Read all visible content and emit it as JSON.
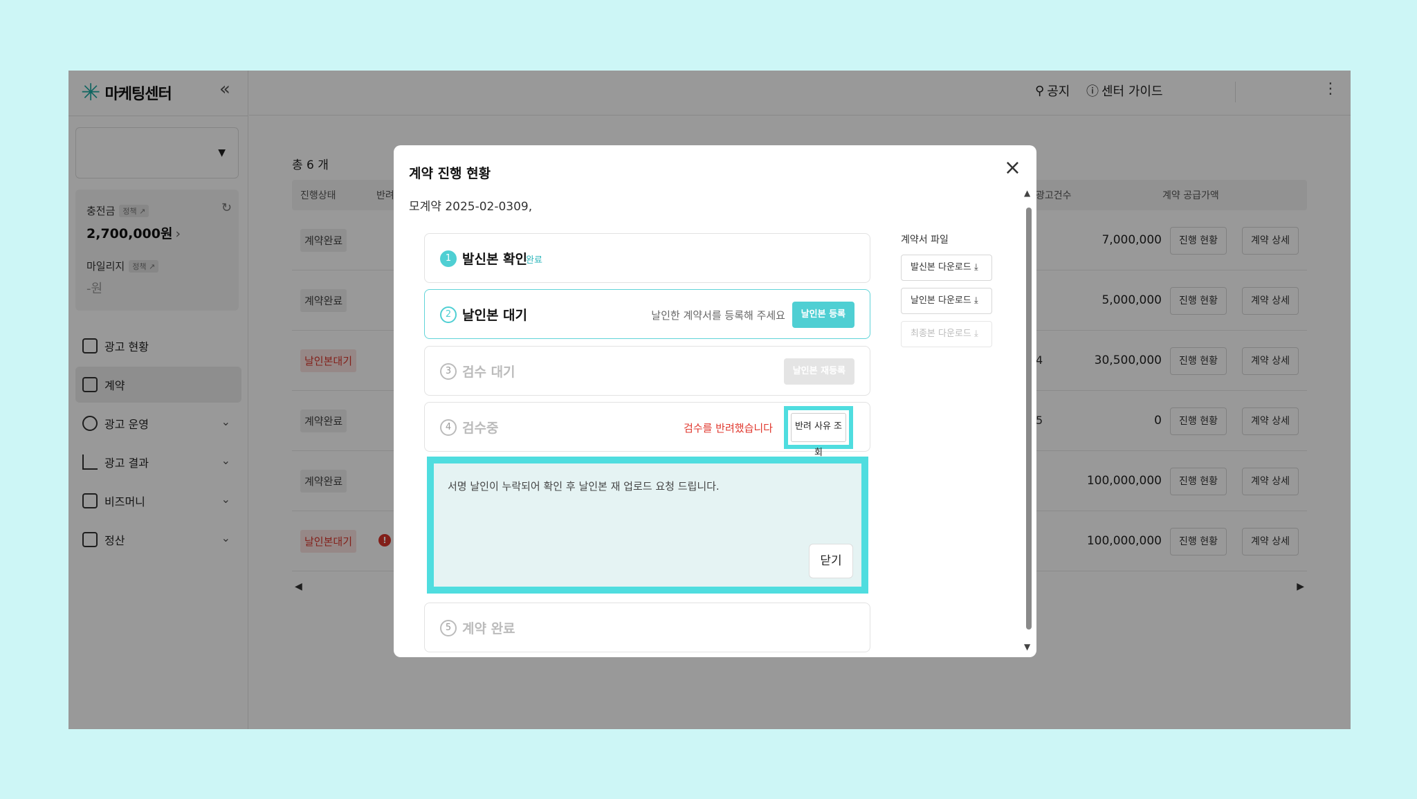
{
  "sidebar": {
    "logo": "마케팅센터",
    "balance_label": "충전금",
    "balance_tag": "정책 ↗",
    "balance_value": "2,700,000원",
    "mileage_label": "마일리지",
    "mileage_tag": "정책 ↗",
    "mileage_value": "-원",
    "nav": [
      {
        "label": "광고 현황",
        "icon": "chart-tree-icon"
      },
      {
        "label": "계약",
        "icon": "clipboard-icon"
      },
      {
        "label": "광고 운영",
        "icon": "target-icon"
      },
      {
        "label": "광고 결과",
        "icon": "line-chart-icon"
      },
      {
        "label": "비즈머니",
        "icon": "wallet-icon"
      },
      {
        "label": "정산",
        "icon": "receipt-icon"
      }
    ]
  },
  "topbar": {
    "notice": "공지",
    "guide": "센터 가이드"
  },
  "list": {
    "total": "총 6 개",
    "headers": [
      "진행상태",
      "반려",
      "광고건수",
      "계약 공급가액"
    ],
    "rows": [
      {
        "status": "계약완료",
        "partial": "",
        "amount": "7,000,000"
      },
      {
        "status": "계약완료",
        "partial": "",
        "amount": "5,000,000"
      },
      {
        "status": "날인본대기",
        "partial": "4",
        "amount": "30,500,000"
      },
      {
        "status": "계약완료",
        "partial": "5",
        "amount": "0"
      },
      {
        "status": "계약완료",
        "partial": "",
        "amount": "100,000,000"
      },
      {
        "status": "날인본대기",
        "partial": "",
        "amount": "100,000,000"
      }
    ],
    "progress_btn": "진행 현황",
    "detail_btn": "계약 상세"
  },
  "modal": {
    "title": "계약 진행 현황",
    "subtitle": "모계약 2025-02-0309,",
    "steps": [
      {
        "num": "1",
        "title": "발신본 확인",
        "badge": "완료"
      },
      {
        "num": "2",
        "title": "날인본 대기",
        "hint": "날인한 계약서를 등록해 주세요",
        "button": "날인본 등록"
      },
      {
        "num": "3",
        "title": "검수 대기",
        "button": "날인본 재등록"
      },
      {
        "num": "4",
        "title": "검수중",
        "hint": "검수를 반려했습니다",
        "button": "반려 사유 조회"
      },
      {
        "num": "5",
        "title": "계약 완료"
      }
    ],
    "reason_text": "서명 날인이 누락되어 확인 후 날인본 재 업로드 요청 드립니다.",
    "reason_close": "닫기",
    "files_title": "계약서 파일",
    "files": [
      "발신본 다운로드",
      "날인본 다운로드",
      "최종본 다운로드"
    ]
  },
  "colors": {
    "accent": "#4fcfd3",
    "highlight": "#4fdddf",
    "danger": "#e0362c",
    "background": "#cdf6f6"
  }
}
